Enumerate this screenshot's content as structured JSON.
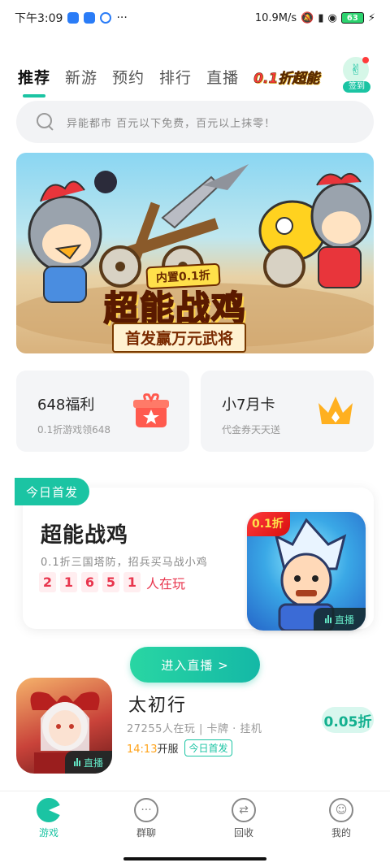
{
  "status_bar": {
    "time": "下午3:09",
    "speed": "10.9M/s",
    "battery": "63"
  },
  "tabs": {
    "items": [
      {
        "label": "推荐"
      },
      {
        "label": "新游"
      },
      {
        "label": "预约"
      },
      {
        "label": "排行"
      },
      {
        "label": "直播"
      }
    ],
    "promo": {
      "prefix": "0.1折",
      "highlight": "超能"
    },
    "signin_label": "签到"
  },
  "search": {
    "placeholder": "异能都市 百元以下免费，百元以上抹零！"
  },
  "banner": {
    "subtitle": "内置0.1折",
    "title": "超能战鸡",
    "tagline": "首发赢万元武将"
  },
  "cards": [
    {
      "title": "648福利",
      "subtitle": "0.1折游戏领648",
      "icon": "gift-icon",
      "color": "#ff5a4e"
    },
    {
      "title": "小7月卡",
      "subtitle": "代金券天天送",
      "icon": "crown-icon",
      "color": "#ffb020"
    }
  ],
  "feature": {
    "badge": "今日首发",
    "title": "超能战鸡",
    "desc": "0.1折三国塔防，招兵买马战小鸡",
    "digits": [
      "2",
      "1",
      "6",
      "5",
      "1"
    ],
    "players_label": "人在玩",
    "art_tag": "0.1折",
    "live_label": "直播",
    "enter_button": "进入直播 >"
  },
  "game": {
    "name": "太初行",
    "meta": "27255人在玩 | 卡牌 · 挂机",
    "time": "14:13",
    "time_suffix": "开服",
    "badge": "今日首发",
    "price": "0.05折",
    "live_label": "直播"
  },
  "bottom_nav": [
    {
      "label": "游戏",
      "icon": "game-icon",
      "active": true
    },
    {
      "label": "群聊",
      "icon": "chat-icon",
      "active": false
    },
    {
      "label": "回收",
      "icon": "recycle-icon",
      "active": false
    },
    {
      "label": "我的",
      "icon": "profile-icon",
      "active": false
    }
  ],
  "colors": {
    "accent": "#1bc4a3",
    "counter": "#e8354d",
    "time_highlight": "#ffa31a"
  }
}
